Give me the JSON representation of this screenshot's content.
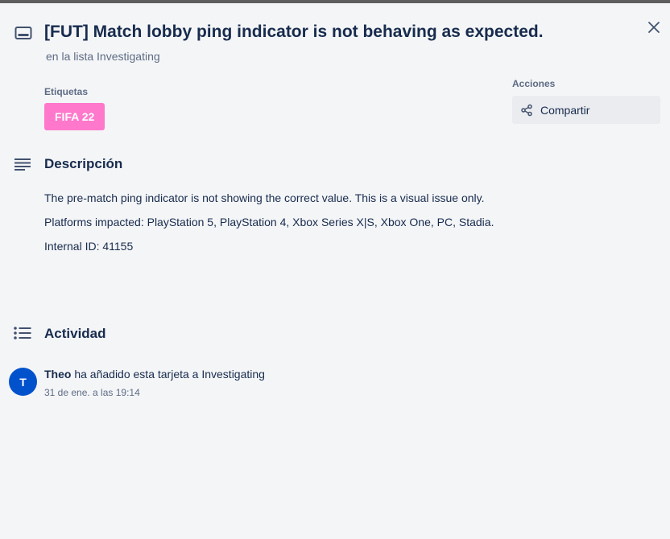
{
  "card": {
    "title": "[FUT] Match lobby ping indicator is not behaving as expected.",
    "list_prefix": "en la lista",
    "list_name": "Investigating"
  },
  "labels": {
    "heading": "Etiquetas",
    "items": [
      {
        "text": "FIFA 22",
        "color": "#ff78cb"
      }
    ]
  },
  "actions": {
    "heading": "Acciones",
    "share_label": "Compartir"
  },
  "description": {
    "heading": "Descripción",
    "paragraphs": [
      "The pre-match ping indicator is not showing the correct value. This is a visual issue only.",
      "Platforms impacted: PlayStation 5, PlayStation 4, Xbox Series X|S, Xbox One, PC, Stadia.",
      "Internal ID: 41155"
    ]
  },
  "activity": {
    "heading": "Actividad",
    "entries": [
      {
        "avatar_initial": "T",
        "user": "Theo",
        "action": "ha añadido esta tarjeta a Investigating",
        "timestamp": "31 de ene. a las 19:14"
      }
    ]
  },
  "icons": {
    "card": "card-icon",
    "close": "close-icon",
    "share": "share-icon",
    "description": "description-icon",
    "activity": "activity-icon"
  },
  "colors": {
    "label_pink": "#ff78cb",
    "avatar_blue": "#0052cc",
    "text": "#172b4d",
    "muted": "#5e6c84"
  }
}
